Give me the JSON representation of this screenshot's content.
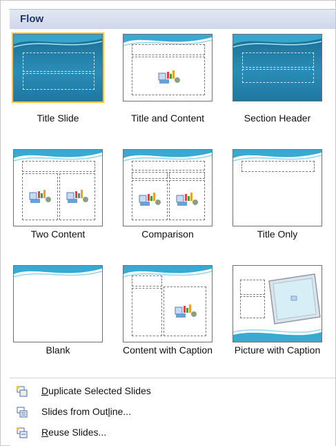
{
  "header": {
    "title": "Flow"
  },
  "layouts": [
    {
      "label": "Title Slide"
    },
    {
      "label": "Title and Content"
    },
    {
      "label": "Section Header"
    },
    {
      "label": "Two Content"
    },
    {
      "label": "Comparison"
    },
    {
      "label": "Title Only"
    },
    {
      "label": "Blank"
    },
    {
      "label": "Content with Caption"
    },
    {
      "label": "Picture with Caption"
    }
  ],
  "menu": [
    {
      "pre": "",
      "acc": "D",
      "post": "uplicate Selected Slides",
      "icon": "duplicate-slides-icon"
    },
    {
      "pre": "Slides from Out",
      "acc": "l",
      "post": "ine...",
      "icon": "outline-icon"
    },
    {
      "pre": "",
      "acc": "R",
      "post": "euse Slides...",
      "icon": "reuse-slides-icon"
    }
  ]
}
